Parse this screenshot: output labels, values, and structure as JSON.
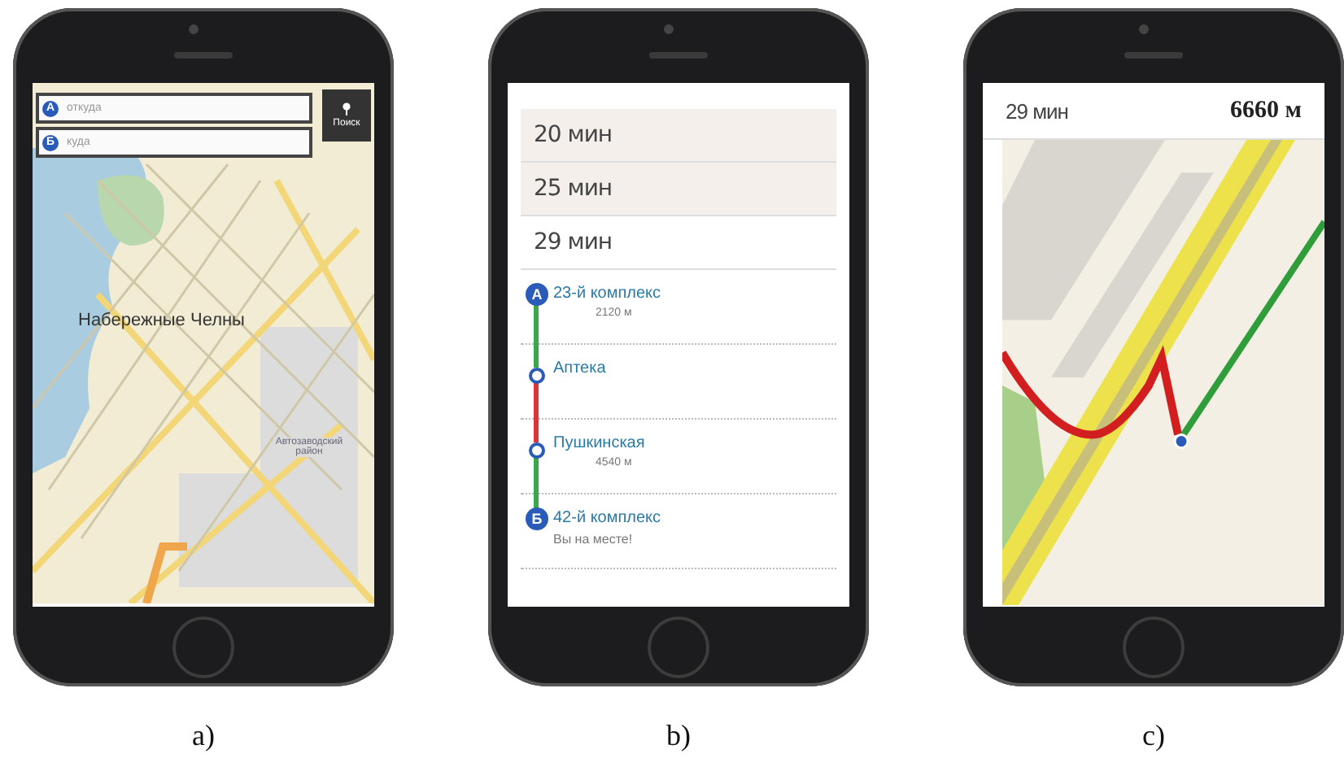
{
  "phones": [
    {
      "kind": "search_map",
      "caption": "a)",
      "fields": [
        {
          "marker": "А",
          "placeholder": "откуда"
        },
        {
          "marker": "Б",
          "placeholder": "куда"
        }
      ],
      "search_button": "Поиск",
      "map_labels": [
        {
          "kind": "city",
          "text": "Набережные Челны"
        },
        {
          "kind": "district",
          "text": "Автозаводский район"
        }
      ]
    },
    {
      "kind": "route_list",
      "caption": "b)",
      "options": [
        {
          "label": "20 мин",
          "selected": false
        },
        {
          "label": "25 мин",
          "selected": false
        },
        {
          "label": "29 мин",
          "selected": true
        }
      ],
      "steps": [
        {
          "kind": "start",
          "marker": "А",
          "name": "23-й комплекс",
          "detail": "2120 м",
          "color": "#3aa84a"
        },
        {
          "kind": "stop",
          "name": "Аптека",
          "color": "#d8343a"
        },
        {
          "kind": "stop",
          "name": "Пушкинская",
          "detail": "4540 м",
          "color": "#3aa84a"
        },
        {
          "kind": "end",
          "marker": "Б",
          "name": "42-й комплекс",
          "detail": "Вы на месте!"
        }
      ]
    },
    {
      "kind": "navigation",
      "caption": "c)",
      "time": "29 мин",
      "distance": "6660 м"
    }
  ]
}
